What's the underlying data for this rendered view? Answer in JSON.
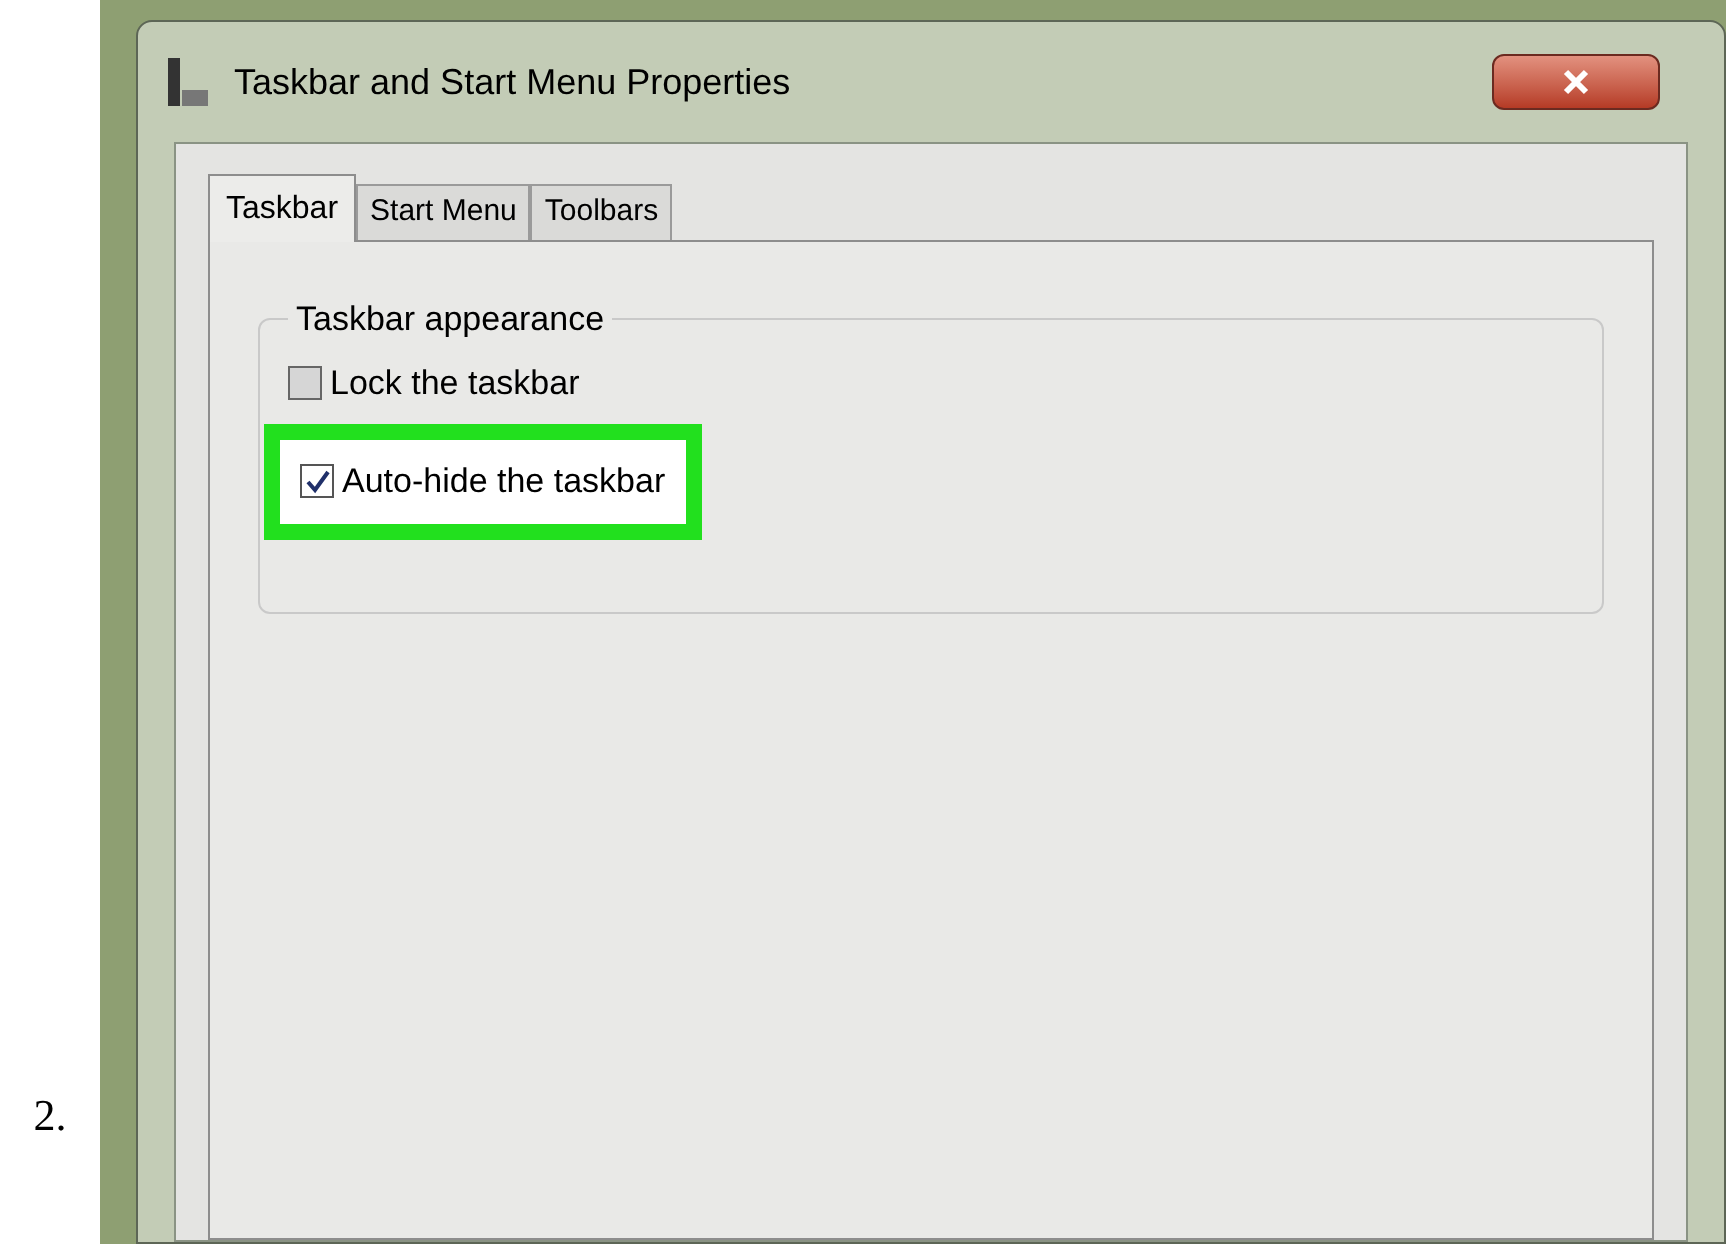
{
  "step": "2.",
  "window": {
    "title": "Taskbar and Start Menu Properties"
  },
  "tabs": [
    {
      "label": "Taskbar",
      "selected": true
    },
    {
      "label": "Start Menu",
      "selected": false
    },
    {
      "label": "Toolbars",
      "selected": false
    }
  ],
  "group": {
    "title": "Taskbar appearance"
  },
  "options": [
    {
      "label": "Lock the taskbar",
      "checked": false,
      "highlighted": false
    },
    {
      "label": "Auto-hide the taskbar",
      "checked": true,
      "highlighted": true
    }
  ]
}
